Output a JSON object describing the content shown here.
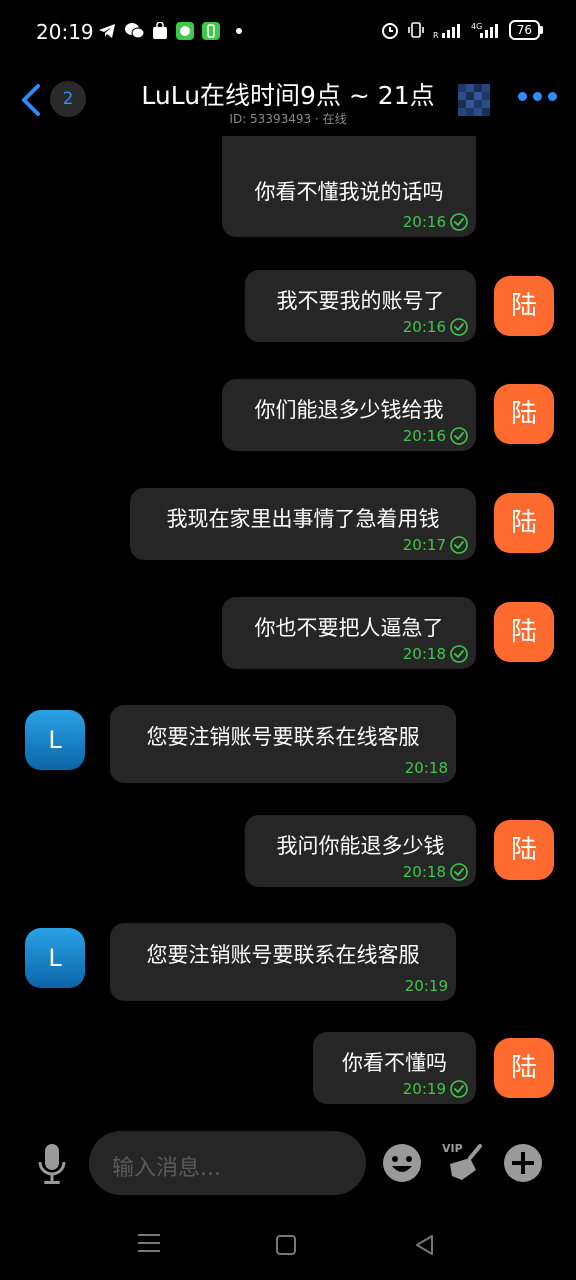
{
  "status_bar": {
    "time": "20:19",
    "left_icons": [
      "telegram-icon",
      "wechat-icon",
      "shopping-bag-icon",
      "green-app-icon",
      "green-app2-icon"
    ],
    "right_icons": [
      "alarm-icon",
      "vibrate-icon",
      "signal-icon",
      "4g-signal-icon"
    ],
    "network": "4G",
    "battery": "76"
  },
  "header": {
    "unread_count": "2",
    "title": "LuLu在线时间9点 ~ 21点",
    "subtitle": "ID: 53393493 · 在线"
  },
  "messages": [
    {
      "side": "me",
      "text": "你看不懂我说的话吗",
      "time": "20:16",
      "read": true,
      "avatar": ""
    },
    {
      "side": "me",
      "text": "我不要我的账号了",
      "time": "20:16",
      "read": true,
      "avatar": "陆"
    },
    {
      "side": "me",
      "text": "你们能退多少钱给我",
      "time": "20:16",
      "read": true,
      "avatar": "陆"
    },
    {
      "side": "me",
      "text": "我现在家里出事情了急着用钱",
      "time": "20:17",
      "read": true,
      "avatar": "陆"
    },
    {
      "side": "me",
      "text": "你也不要把人逼急了",
      "time": "20:18",
      "read": true,
      "avatar": "陆"
    },
    {
      "side": "other",
      "text": "您要注销账号要联系在线客服",
      "time": "20:18",
      "avatar": "L"
    },
    {
      "side": "me",
      "text": "我问你能退多少钱",
      "time": "20:18",
      "read": true,
      "avatar": "陆"
    },
    {
      "side": "other",
      "text": "您要注销账号要联系在线客服",
      "time": "20:19",
      "avatar": "L"
    },
    {
      "side": "me",
      "text": "你看不懂吗",
      "time": "20:19",
      "read": true,
      "avatar": "陆"
    }
  ],
  "input": {
    "placeholder": "输入消息..."
  },
  "toolbar": {
    "vip_label": "VIP"
  },
  "colors": {
    "accent": "#2f8bff",
    "bubble": "#262626",
    "time_green": "#3ec84a",
    "my_avatar": "#ff6a2f"
  }
}
